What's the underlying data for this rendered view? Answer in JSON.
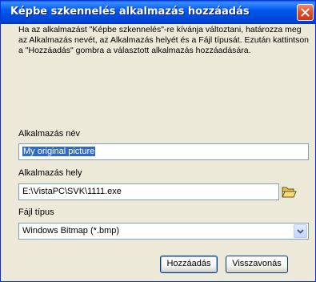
{
  "dialog": {
    "title": "Képbe szkennelés alkalmazás hozzáadás",
    "description": "Ha az alkalmazást \"Képbe szkennelés\"-re kívánja változtani, határozza meg az Alkalmazás nevét, az Alkalmazás helyét és a Fájl típusát. Ezután kattintson a \"Hozzáadás\" gombra a választott alkalmazás hozzáadására."
  },
  "fields": {
    "app_name_label": "Alkalmazás név",
    "app_name_value": "My original picture",
    "app_location_label": "Alkalmazás hely",
    "app_location_value": "E:\\VistaPC\\SVK\\1111.exe",
    "file_type_label": "Fájl típus",
    "file_type_value": "Windows Bitmap (*.bmp)"
  },
  "buttons": {
    "add": "Hozzáadás",
    "cancel": "Visszavonás"
  },
  "icons": {
    "close": "close-icon",
    "browse": "folder-open-icon",
    "dropdown": "chevron-down-icon"
  },
  "colors": {
    "titlebar": "#0058ee",
    "close": "#e0522c",
    "selection": "#316ac5",
    "face": "#ece9d8"
  }
}
